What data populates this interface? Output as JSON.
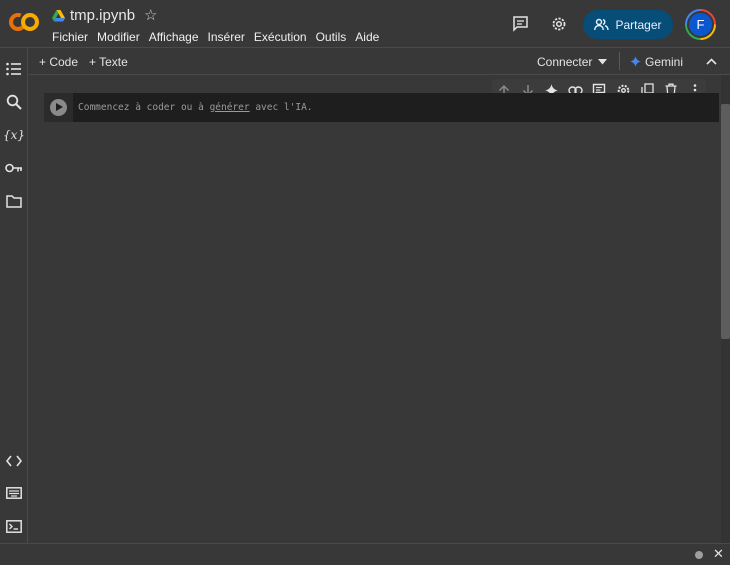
{
  "header": {
    "title": "tmp.ipynb",
    "menu": [
      "Fichier",
      "Modifier",
      "Affichage",
      "Insérer",
      "Exécution",
      "Outils",
      "Aide"
    ],
    "share_label": "Partager",
    "avatar_initial": "F",
    "icons": [
      "comments-icon",
      "settings-icon",
      "star-icon",
      "google-drive-icon"
    ]
  },
  "toolbar": {
    "add_code": "+ Code",
    "add_text": "+ Texte",
    "connect": "Connecter",
    "gemini": "Gemini"
  },
  "sidebar": {
    "icons": [
      "table-of-contents-icon",
      "search-icon",
      "variables-icon",
      "secrets-key-icon",
      "files-folder-icon",
      "code-snippets-icon",
      "command-palette-icon",
      "terminal-icon"
    ]
  },
  "cell_toolbar": {
    "icons": [
      "move-up-icon",
      "move-down-icon",
      "gemini-sparkle-icon",
      "link-icon",
      "comment-icon",
      "cell-settings-icon",
      "mirror-cell-icon",
      "delete-icon",
      "more-options-icon"
    ]
  },
  "cell": {
    "placeholder_before": "Commencez à coder ou à ",
    "placeholder_link": "générer",
    "placeholder_after": " avec l'IA."
  },
  "colors": {
    "background": "#383838",
    "share_button": "#064d78",
    "avatar": "#0b57d0",
    "logo_orange": "#f9ab00",
    "gemini_blue": "#4285f4"
  }
}
